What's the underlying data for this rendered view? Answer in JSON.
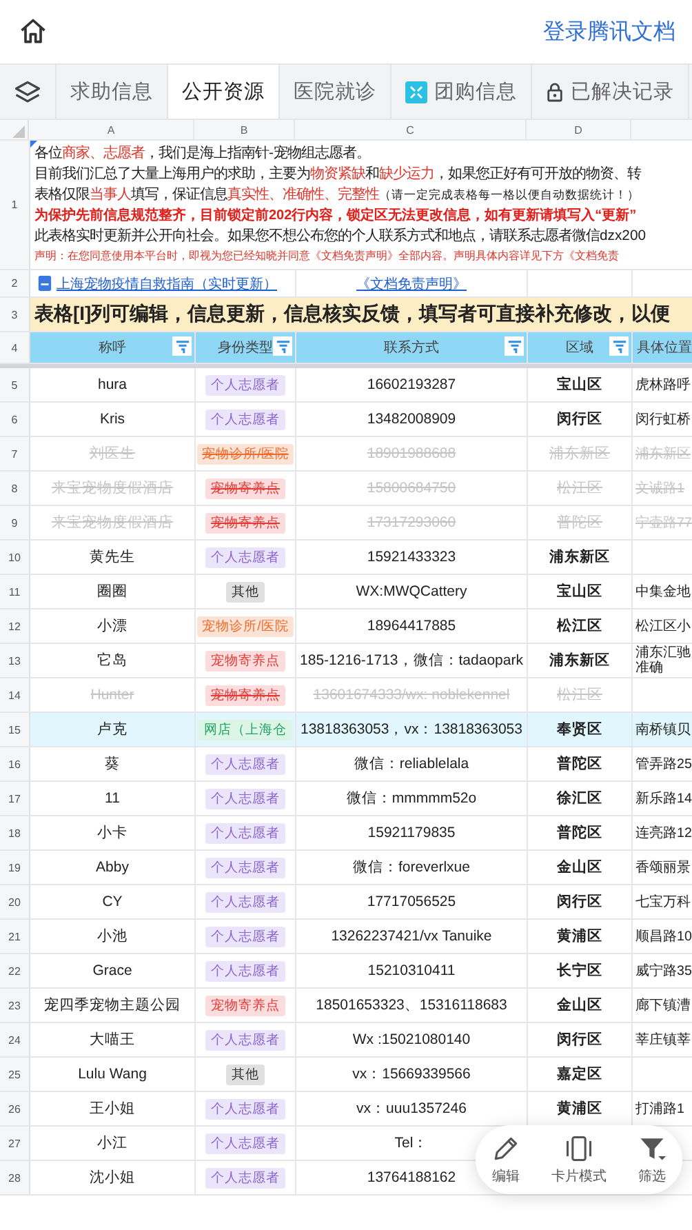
{
  "top_bar": {
    "login_link": "登录腾讯文档"
  },
  "tabs": [
    {
      "label": "求助信息",
      "selected": false,
      "kind": "plain"
    },
    {
      "label": "公开资源",
      "selected": true,
      "kind": "plain"
    },
    {
      "label": "医院就诊",
      "selected": false,
      "kind": "plain"
    },
    {
      "label": "团购信息",
      "selected": false,
      "kind": "tile"
    },
    {
      "label": "已解决记录",
      "selected": false,
      "kind": "locked"
    }
  ],
  "sheet": {
    "column_letters": [
      "A",
      "B",
      "C",
      "D"
    ],
    "row_1_number": "1",
    "notice_lines": [
      [
        {
          "text": "各位",
          "kind": "plain"
        },
        {
          "text": "商家、志愿者",
          "kind": "red"
        },
        {
          "text": "，我们是海上指南针-宠物组志愿者。",
          "kind": "plain"
        }
      ],
      [
        {
          "text": "目前我们汇总了大量上海用户的求助，主要为",
          "kind": "plain"
        },
        {
          "text": "物资紧缺",
          "kind": "red"
        },
        {
          "text": "和",
          "kind": "plain"
        },
        {
          "text": "缺少运力",
          "kind": "red"
        },
        {
          "text": "，如果您正好有可开放的物资、转",
          "kind": "plain"
        }
      ],
      [
        {
          "text": "表格仅限",
          "kind": "plain"
        },
        {
          "text": "当事人",
          "kind": "red"
        },
        {
          "text": "填写，保证信息",
          "kind": "plain"
        },
        {
          "text": "真实性、准确性、完整性",
          "kind": "red"
        },
        {
          "text": "（请一定完成表格每一格以便自动数据统计！）",
          "kind": "note"
        }
      ],
      [
        {
          "text": "为保护先前信息规范整齐，目前锁定前202行内容，锁定区无法更改信息，如有更新请填写入“更新”",
          "kind": "bold_red"
        }
      ],
      [
        {
          "text": "此表格实时更新并公开向社会。如果您不想公布您的个人联系方式和地点，请联系志愿者微信dzx200",
          "kind": "plain"
        }
      ],
      [
        {
          "text": "声明：在您同意使用本平台时，即视为您已经知晓并同意《文档免责声明》全部内容。声明具体内容详见下方《文档免责",
          "kind": "small_red"
        }
      ]
    ],
    "row_2_number": "2",
    "guide_link": "上海宠物疫情自救指南（实时更新）",
    "disclaimer_link": "《文档免责声明》",
    "row_3_number": "3",
    "banner": "表格[I]列可编辑，信息更新，信息核实反馈，填写者可直接补充修改，以便",
    "row_4_number": "4",
    "headers": [
      {
        "label": "称呼",
        "filter": true
      },
      {
        "label": "身份类型",
        "filter": true
      },
      {
        "label": "联系方式",
        "filter": true
      },
      {
        "label": "区域",
        "filter": true
      },
      {
        "label": "具体位置",
        "filter": false
      }
    ],
    "rows": [
      {
        "num": "5",
        "name": "hura",
        "type": "个人志愿者",
        "kind": "volunteer",
        "contact": "16602193287",
        "district": "宝山区",
        "location": "虎林路呼",
        "struck": false,
        "selected": false
      },
      {
        "num": "6",
        "name": "Kris",
        "type": "个人志愿者",
        "kind": "volunteer",
        "contact": "13482008909",
        "district": "闵行区",
        "location": "闵行虹桥",
        "struck": false,
        "selected": false
      },
      {
        "num": "7",
        "name": "刘医生",
        "type": "宠物诊所/医院",
        "kind": "clinic",
        "contact": "18901988688",
        "district": "浦东新区",
        "location": "浦东新区",
        "struck": true,
        "selected": false
      },
      {
        "num": "8",
        "name": "来宝宠物度假酒店",
        "type": "宠物寄养点",
        "kind": "boarding",
        "contact": "15800684750",
        "district": "松江区",
        "location": "文诚路1",
        "struck": true,
        "selected": false
      },
      {
        "num": "9",
        "name": "来宝宠物度假酒店",
        "type": "宠物寄养点",
        "kind": "boarding",
        "contact": "17317293060",
        "district": "普陀区",
        "location": "宁壶路77",
        "struck": true,
        "selected": false
      },
      {
        "num": "10",
        "name": "黄先生",
        "type": "个人志愿者",
        "kind": "volunteer",
        "contact": "15921433323",
        "district": "浦东新区",
        "struck": false,
        "selected": false
      },
      {
        "num": "11",
        "name": "圈圈",
        "type": "其他",
        "kind": "other",
        "contact": "WX:MWQCattery",
        "district": "宝山区",
        "location": "中集金地",
        "struck": false,
        "selected": false
      },
      {
        "num": "12",
        "name": "小漂",
        "type": "宠物诊所/医院",
        "kind": "clinic",
        "contact": "18964417885",
        "district": "松江区",
        "location": "松江区小",
        "struck": false,
        "selected": false
      },
      {
        "num": "13",
        "name": "它岛",
        "type": "宠物寄养点",
        "kind": "boarding",
        "contact": "185-1216-1713，微信：tadaopark",
        "district": "浦东新区",
        "location": "浦东汇驰准确",
        "struck": false,
        "selected": false
      },
      {
        "num": "14",
        "name": "Hunter",
        "type": "宠物寄养点",
        "kind": "boarding",
        "contact": "13601674333/wx: noblekennel",
        "district": "松江区",
        "struck": true,
        "selected": false
      },
      {
        "num": "15",
        "name": "卢克",
        "type": "网店（上海仓",
        "kind": "shop",
        "contact": "13818363053，vx：13818363053",
        "district": "奉贤区",
        "location": "南桥镇贝",
        "struck": false,
        "selected": true
      },
      {
        "num": "16",
        "name": "葵",
        "type": "个人志愿者",
        "kind": "volunteer",
        "contact": "微信：reliablelala",
        "district": "普陀区",
        "location": "管弄路25",
        "struck": false,
        "selected": false
      },
      {
        "num": "17",
        "name": "11",
        "type": "个人志愿者",
        "kind": "volunteer",
        "contact": "微信：mmmmm52o",
        "district": "徐汇区",
        "location": "新乐路14",
        "struck": false,
        "selected": false
      },
      {
        "num": "18",
        "name": "小卡",
        "type": "个人志愿者",
        "kind": "volunteer",
        "contact": "15921179835",
        "district": "普陀区",
        "location": "连亮路12",
        "struck": false,
        "selected": false
      },
      {
        "num": "19",
        "name": "Abby",
        "type": "个人志愿者",
        "kind": "volunteer",
        "contact": "微信：foreverlxue",
        "district": "金山区",
        "location": "香颂丽景",
        "struck": false,
        "selected": false
      },
      {
        "num": "20",
        "name": "CY",
        "type": "个人志愿者",
        "kind": "volunteer",
        "contact": "17717056525",
        "district": "闵行区",
        "location": "七宝万科",
        "struck": false,
        "selected": false
      },
      {
        "num": "21",
        "name": "小池",
        "type": "个人志愿者",
        "kind": "volunteer",
        "contact": "13262237421/vx Tanuike",
        "district": "黄浦区",
        "location": "顺昌路10",
        "struck": false,
        "selected": false
      },
      {
        "num": "22",
        "name": "Grace",
        "type": "个人志愿者",
        "kind": "volunteer",
        "contact": "15210310411",
        "district": "长宁区",
        "location": "威宁路35",
        "struck": false,
        "selected": false
      },
      {
        "num": "23",
        "name": "宠四季宠物主题公园",
        "type": "宠物寄养点",
        "kind": "boarding",
        "contact": "18501653323、15316118683",
        "district": "金山区",
        "location": "廊下镇漕",
        "struck": false,
        "selected": false
      },
      {
        "num": "24",
        "name": "大喵王",
        "type": "个人志愿者",
        "kind": "volunteer",
        "contact": "Wx :15021080140",
        "district": "闵行区",
        "location": "莘庄镇莘",
        "struck": false,
        "selected": false
      },
      {
        "num": "25",
        "name": "Lulu Wang",
        "type": "其他",
        "kind": "other",
        "contact": "vx：15669339566",
        "district": "嘉定区",
        "struck": false,
        "selected": false
      },
      {
        "num": "26",
        "name": "王小姐",
        "type": "个人志愿者",
        "kind": "volunteer",
        "contact": "vx：uuu1357246",
        "district": "黄浦区",
        "location": "打浦路1",
        "struck": false,
        "selected": false
      },
      {
        "num": "27",
        "name": "小江",
        "type": "个人志愿者",
        "kind": "volunteer",
        "contact": "Tel：",
        "struck": false,
        "selected": false
      },
      {
        "num": "28",
        "name": "沈小姐",
        "type": "个人志愿者",
        "kind": "volunteer",
        "contact": "13764188162",
        "struck": false,
        "selected": false
      }
    ]
  },
  "toolbar": [
    {
      "label": "编辑",
      "kind": "edit"
    },
    {
      "label": "卡片模式",
      "kind": "card"
    },
    {
      "label": "筛选",
      "kind": "filter"
    }
  ]
}
